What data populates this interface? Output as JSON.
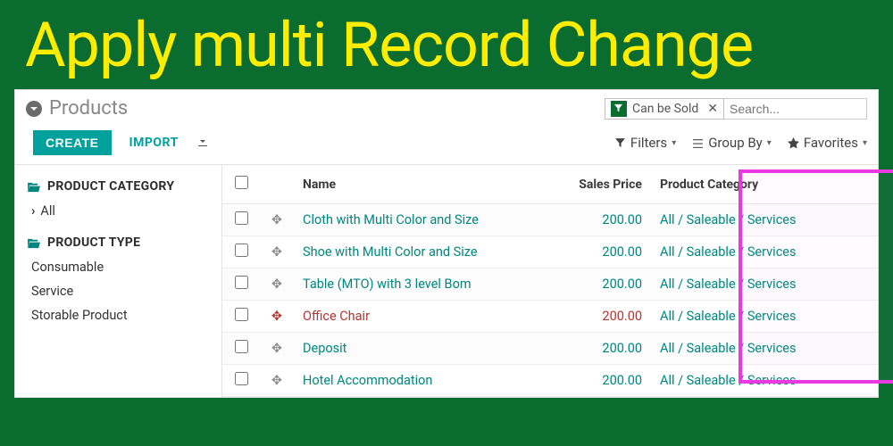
{
  "banner": {
    "title": "Apply multi Record Change"
  },
  "breadcrumb": {
    "title": "Products"
  },
  "search": {
    "chip_label": "Can be Sold",
    "placeholder": "Search..."
  },
  "toolbar": {
    "create": "CREATE",
    "import": "IMPORT",
    "filters": "Filters",
    "groupby": "Group By",
    "favorites": "Favorites"
  },
  "sidebar": {
    "cat_header": "PRODUCT CATEGORY",
    "cat_all": "All",
    "type_header": "PRODUCT TYPE",
    "types": [
      "Consumable",
      "Service",
      "Storable Product"
    ]
  },
  "columns": {
    "name": "Name",
    "price": "Sales Price",
    "category": "Product Category"
  },
  "rows": [
    {
      "name": "Cloth with Multi Color and Size",
      "price": "200.00",
      "category": "All / Saleable / Services",
      "danger": false
    },
    {
      "name": "Shoe with Multi Color and Size",
      "price": "200.00",
      "category": "All / Saleable / Services",
      "danger": false
    },
    {
      "name": "Table (MTO) with 3 level Bom",
      "price": "200.00",
      "category": "All / Saleable / Services",
      "danger": false
    },
    {
      "name": "Office Chair",
      "price": "200.00",
      "category": "All / Saleable / Services",
      "danger": true
    },
    {
      "name": "Deposit",
      "price": "200.00",
      "category": "All / Saleable / Services",
      "danger": false
    },
    {
      "name": "Hotel Accommodation",
      "price": "200.00",
      "category": "All / Saleable / Services",
      "danger": false
    }
  ]
}
